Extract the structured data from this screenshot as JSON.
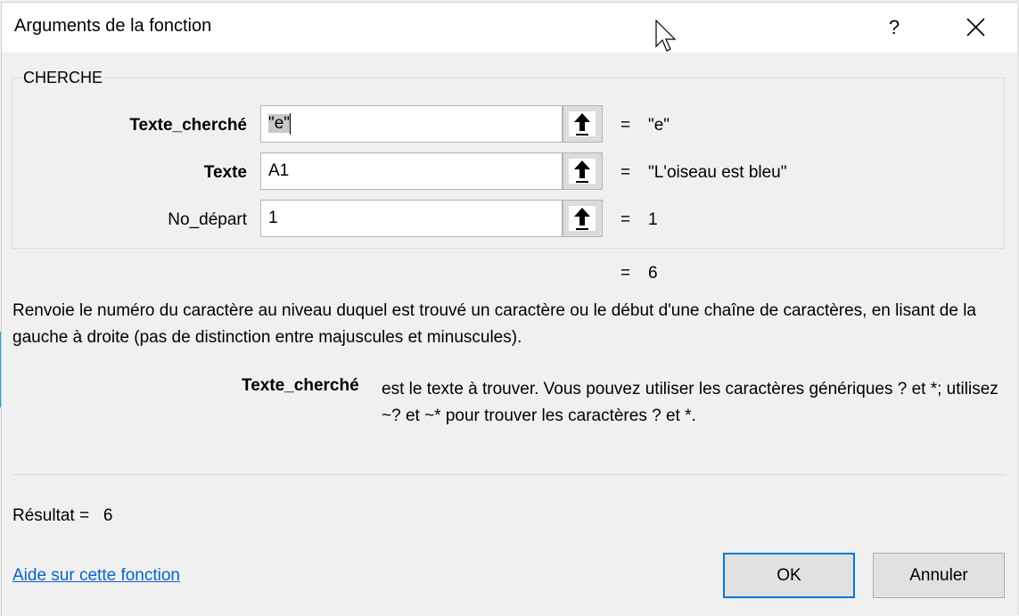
{
  "window": {
    "title": "Arguments de la fonction",
    "help_label": "?",
    "close_icon": "close-icon"
  },
  "function": {
    "name": "CHERCHE",
    "arguments": [
      {
        "label": "Texte_cherché",
        "bold": true,
        "value": "\"e\"",
        "evaluated": "\"e\"",
        "selected": true
      },
      {
        "label": "Texte",
        "bold": true,
        "value": "A1",
        "evaluated": "\"L'oiseau est bleu\"",
        "selected": false
      },
      {
        "label": "No_départ",
        "bold": false,
        "value": "1",
        "evaluated": "1",
        "selected": false
      }
    ],
    "equals_sign": "=",
    "formula_result": "6",
    "description": "Renvoie le numéro du caractère au niveau duquel est trouvé un caractère ou le début d'une chaîne de caractères, en lisant de la gauche à droite (pas de distinction entre majuscules et minuscules).",
    "param_help": {
      "name": "Texte_cherché",
      "text": "est le texte à trouver. Vous pouvez utiliser les caractères génériques ? et *; utilisez ~? et ~* pour trouver les caractères ? et *."
    }
  },
  "footer": {
    "result_label": "Résultat =",
    "result_value": "6",
    "help_link": "Aide sur cette fonction",
    "ok_label": "OK",
    "cancel_label": "Annuler"
  },
  "colors": {
    "accent": "#0078d7",
    "link": "#0a63c9",
    "background": "#f0f0f0"
  }
}
